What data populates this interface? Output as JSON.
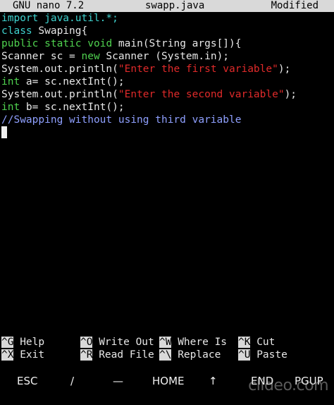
{
  "titlebar": {
    "app": "GNU nano 7.2",
    "filename": "swapp.java",
    "status": "Modified"
  },
  "code": {
    "line1": "import java.util.*;",
    "line2_kw": "class",
    "line2_rest": " Swaping{",
    "line3_kw1": "public",
    "line3_kw2": "static",
    "line3_kw3": "void",
    "line3_rest": " main(String args[]){",
    "line4_a": "Scanner sc = ",
    "line4_kw": "new",
    "line4_b": " Scanner (System.in);",
    "line5_a": "System.out.println(",
    "line5_str": "\"Enter the first variable\"",
    "line5_b": ");",
    "line6_kw": "int",
    "line6_rest": " a= sc.nextInt();",
    "line7_a": "System.out.println(",
    "line7_str": "\"Enter the second variable\"",
    "line7_b": ");",
    "line8_kw": "int",
    "line8_rest": " b= sc.nextInt();",
    "line9_comment": "//Swapping without using third variable"
  },
  "shortcuts": {
    "help_key": "^G",
    "help_label": " Help",
    "exit_key": "^X",
    "exit_label": " Exit",
    "write_key": "^O",
    "write_label": " Write Out",
    "read_key": "^R",
    "read_label": " Read File",
    "where_key": "^W",
    "where_label": " Where Is",
    "replace_key": "^\\",
    "replace_label": " Replace",
    "cut_key": "^K",
    "cut_label": " Cut",
    "paste_key": "^U",
    "paste_label": " Paste"
  },
  "keyboard_bar": {
    "esc": "ESC",
    "slash": "/",
    "dash": "—",
    "home": "HOME",
    "up": "↑",
    "end": "END",
    "pgup": "PGUP"
  },
  "watermark": "clideo.com",
  "colors": {
    "keyword_cyan": "#3fd2ce",
    "keyword_green": "#4fd24f",
    "string_red": "#e02a2a",
    "comment_blue": "#8fa0ff",
    "titlebar_bg": "#d9d9d9"
  }
}
